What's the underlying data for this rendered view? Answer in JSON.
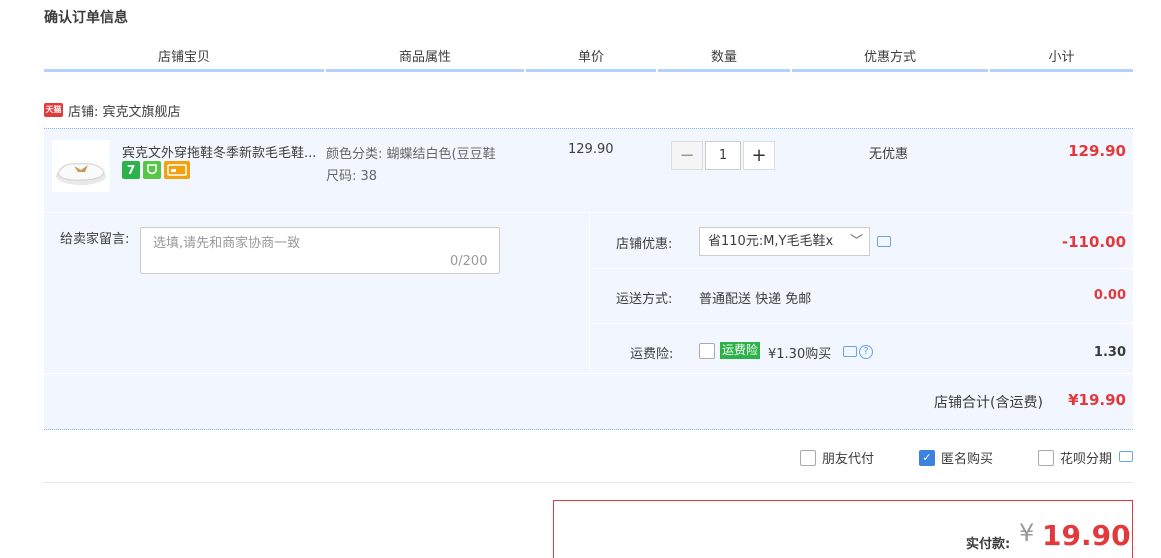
{
  "page_title": "确认订单信息",
  "columns": [
    "店铺宝贝",
    "商品属性",
    "单价",
    "数量",
    "优惠方式",
    "小计"
  ],
  "shop": {
    "badge": "天猫",
    "name": "店铺: 宾克文旗舰店"
  },
  "item": {
    "title": "宾克文外穿拖鞋冬季新款毛毛鞋...",
    "color_attr": "颜色分类: 蝴蝶结白色(豆豆鞋",
    "size_attr": "尺码: 38",
    "unit_price": "129.90",
    "quantity": "1",
    "discount": "无优惠",
    "subtotal": "129.90",
    "icons": [
      "seven-day-return-icon",
      "guarantee-icon",
      "card-icon"
    ],
    "icon_text": {
      "seven": "7"
    }
  },
  "message": {
    "label": "给卖家留言:",
    "placeholder": "选填,请先和商家协商一致",
    "count": "0/200"
  },
  "shop_discount": {
    "label": "店铺优惠:",
    "selected": "省110元:M,Y毛毛鞋x",
    "amount": "-110.00"
  },
  "shipping": {
    "label": "运送方式:",
    "value": "普通配送 快递 免邮",
    "amount": "0.00"
  },
  "insurance": {
    "label": "运费险:",
    "badge": "运费险",
    "text": "¥1.30购买",
    "amount": "1.30"
  },
  "shop_total": {
    "label": "店铺合计(含运费)",
    "amount": "¥19.90"
  },
  "options": [
    {
      "label": "朋友代付",
      "checked": false
    },
    {
      "label": "匿名购买",
      "checked": true
    },
    {
      "label": "花呗分期",
      "checked": false
    }
  ],
  "payment": {
    "label": "实付款:",
    "currency": "¥",
    "amount": "19.90"
  },
  "colors": {
    "accent_red": "#e4393c",
    "panel_blue": "#f2f7ff",
    "header_rule": "#b2d1ff",
    "check_blue": "#3c83e0"
  }
}
